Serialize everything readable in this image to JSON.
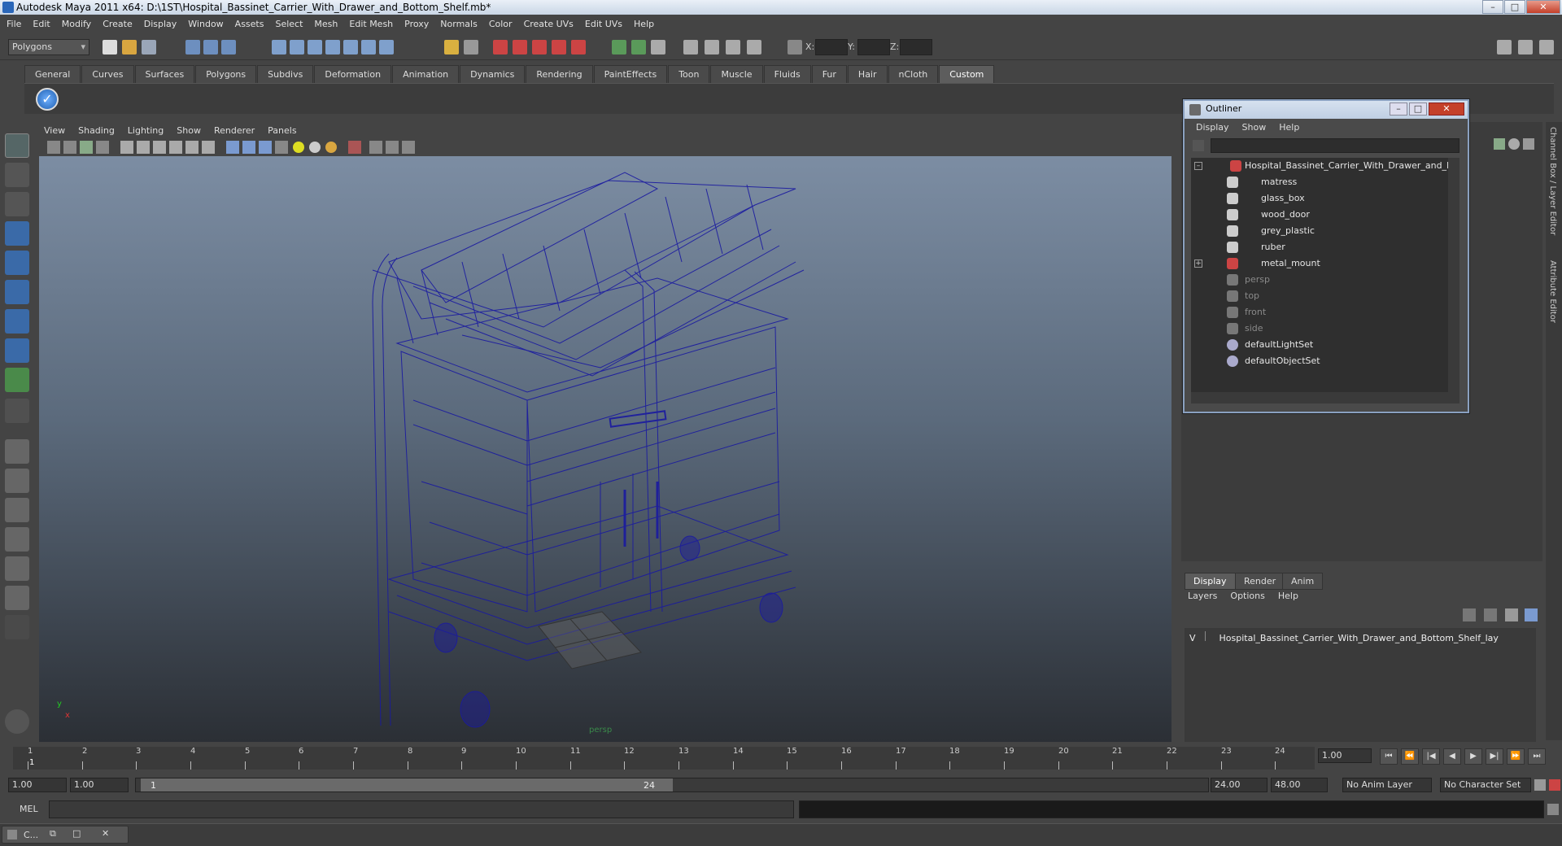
{
  "window": {
    "title": "Autodesk Maya 2011 x64: D:\\1ST\\Hospital_Bassinet_Carrier_With_Drawer_and_Bottom_Shelf.mb*"
  },
  "menubar": [
    "File",
    "Edit",
    "Modify",
    "Create",
    "Display",
    "Window",
    "Assets",
    "Select",
    "Mesh",
    "Edit Mesh",
    "Proxy",
    "Normals",
    "Color",
    "Create UVs",
    "Edit UVs",
    "Help"
  ],
  "status": {
    "mode": "Polygons",
    "x_label": "X:",
    "y_label": "Y:",
    "z_label": "Z:"
  },
  "shelf_tabs": [
    "General",
    "Curves",
    "Surfaces",
    "Polygons",
    "Subdivs",
    "Deformation",
    "Animation",
    "Dynamics",
    "Rendering",
    "PaintEffects",
    "Toon",
    "Muscle",
    "Fluids",
    "Fur",
    "Hair",
    "nCloth",
    "Custom"
  ],
  "shelf_active": "Custom",
  "viewport": {
    "menu": [
      "View",
      "Shading",
      "Lighting",
      "Show",
      "Renderer",
      "Panels"
    ],
    "camera_label": "persp",
    "axis_y": "y",
    "axis_x": "x"
  },
  "outliner": {
    "title": "Outliner",
    "menu": [
      "Display",
      "Show",
      "Help"
    ],
    "items": [
      {
        "label": "Hospital_Bassinet_Carrier_With_Drawer_and_Bottc",
        "kind": "group"
      },
      {
        "label": "matress",
        "kind": "mesh"
      },
      {
        "label": "glass_box",
        "kind": "mesh"
      },
      {
        "label": "wood_door",
        "kind": "mesh"
      },
      {
        "label": "grey_plastic",
        "kind": "mesh"
      },
      {
        "label": "ruber",
        "kind": "mesh"
      },
      {
        "label": "metal_mount",
        "kind": "group"
      },
      {
        "label": "persp",
        "kind": "camera"
      },
      {
        "label": "top",
        "kind": "camera"
      },
      {
        "label": "front",
        "kind": "camera"
      },
      {
        "label": "side",
        "kind": "camera"
      },
      {
        "label": "defaultLightSet",
        "kind": "set"
      },
      {
        "label": "defaultObjectSet",
        "kind": "set"
      }
    ]
  },
  "right_side_tabs": [
    "Channel Box / Layer Editor",
    "Attribute Editor"
  ],
  "layer_editor": {
    "tabs": [
      "Display",
      "Render",
      "Anim"
    ],
    "menu": [
      "Layers",
      "Options",
      "Help"
    ],
    "layer_visible": "V",
    "layer_name": "Hospital_Bassinet_Carrier_With_Drawer_and_Bottom_Shelf_lay"
  },
  "timeline": {
    "ticks": [
      "1",
      "2",
      "3",
      "4",
      "5",
      "6",
      "7",
      "8",
      "9",
      "10",
      "11",
      "12",
      "13",
      "14",
      "15",
      "16",
      "17",
      "18",
      "19",
      "20",
      "21",
      "22",
      "23",
      "24"
    ],
    "current_frame_marker": "1",
    "current_time": "1.00"
  },
  "range": {
    "start": "1.00",
    "playback_start": "1.00",
    "slider_start": "1",
    "slider_end": "24",
    "playback_end": "24.00",
    "end": "48.00",
    "anim_layer": "No Anim Layer",
    "character_set": "No Character Set"
  },
  "mel": {
    "label": "MEL"
  },
  "taskbar": {
    "label": "C..."
  }
}
